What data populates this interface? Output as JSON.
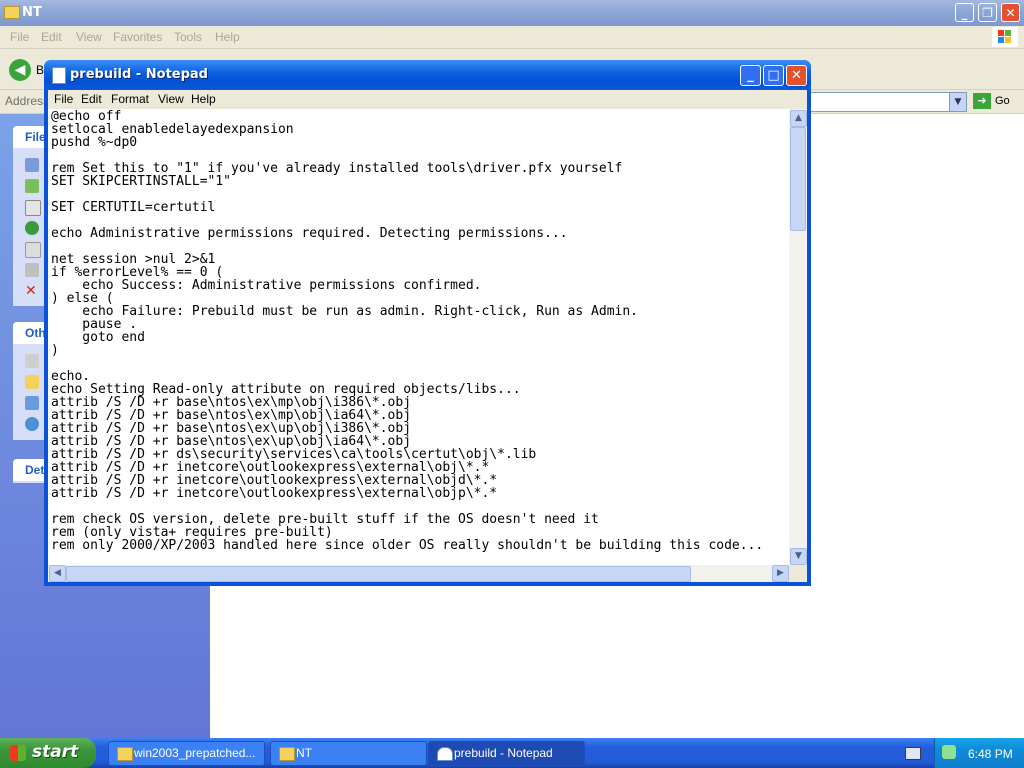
{
  "explorer": {
    "title": "NT",
    "menu": [
      "File",
      "Edit",
      "View",
      "Favorites",
      "Tools",
      "Help"
    ],
    "back_label": "B",
    "address_label": "Address",
    "go_label": "Go",
    "panels": [
      "File",
      "Oth",
      "Det"
    ]
  },
  "notepad": {
    "title": "prebuild - Notepad",
    "menu": [
      "File",
      "Edit",
      "Format",
      "View",
      "Help"
    ],
    "buttons": {
      "minimize": "_",
      "maximize": "□",
      "close": "✕"
    },
    "text": "@echo off\nsetlocal enabledelayedexpansion\npushd %~dp0\n\nrem Set this to \"1\" if you've already installed tools\\driver.pfx yourself\nSET SKIPCERTINSTALL=\"1\"\n\nSET CERTUTIL=certutil\n\necho Administrative permissions required. Detecting permissions...\n\nnet session >nul 2>&1\nif %errorLevel% == 0 (\n    echo Success: Administrative permissions confirmed.\n) else (\n    echo Failure: Prebuild must be run as admin. Right-click, Run as Admin.\n    pause .\n    goto end\n)\n\necho.\necho Setting Read-only attribute on required objects/libs...\nattrib /S /D +r base\\ntos\\ex\\mp\\obj\\i386\\*.obj\nattrib /S /D +r base\\ntos\\ex\\mp\\obj\\ia64\\*.obj\nattrib /S /D +r base\\ntos\\ex\\up\\obj\\i386\\*.obj\nattrib /S /D +r base\\ntos\\ex\\up\\obj\\ia64\\*.obj\nattrib /S /D +r ds\\security\\services\\ca\\tools\\certut\\obj\\*.lib\nattrib /S /D +r inetcore\\outlookexpress\\external\\obj\\*.*\nattrib /S /D +r inetcore\\outlookexpress\\external\\objd\\*.*\nattrib /S /D +r inetcore\\outlookexpress\\external\\objp\\*.*\n\nrem check OS version, delete pre-built stuff if the OS doesn't need it\nrem (only vista+ requires pre-built)\nrem only 2000/XP/2003 handled here since older OS really shouldn't be building this code..."
  },
  "taskbar": {
    "start_label": "start",
    "items": [
      {
        "label": "win2003_prepatched...",
        "icon": "folder-icon",
        "active": false
      },
      {
        "label": "NT",
        "icon": "folder-icon",
        "active": false
      },
      {
        "label": "prebuild - Notepad",
        "icon": "notepad-icon",
        "active": true
      }
    ],
    "clock": "6:48 PM"
  }
}
